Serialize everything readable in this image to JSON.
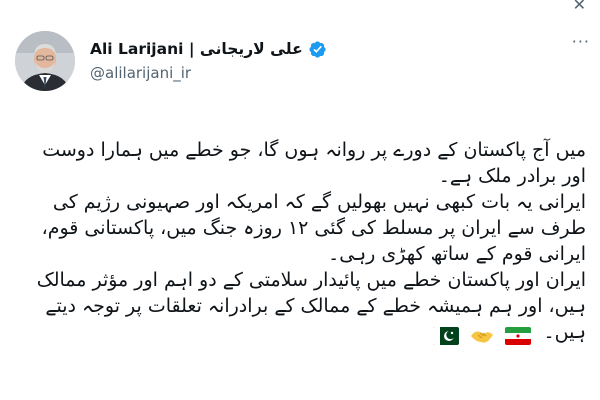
{
  "header": {
    "display_name": "Ali Larijani | علی لاریجانی",
    "handle": "@alilarijani_ir",
    "verified": true,
    "close_icon": "close-icon",
    "more_icon": "more-options-icon"
  },
  "tweet": {
    "text": "میں آج پاکستان کے دورے پر روانہ ہوں گا، جو خطے میں ہمارا دوست اور برادر ملک ہے۔\nایرانی یہ بات کبھی نہیں بھولیں گے کہ امریکہ اور صہیونی رژیم کی طرف سے ایران پر مسلط کی گئی ۱۲ روزہ جنگ میں، پاکستانی قوم، ایرانی قوم کے ساتھ کھڑی رہی۔\nایران اور پاکستان خطے میں پائیدار سلامتی کے دو اہم اور مؤثر ممالک ہیں، اور ہم ہمیشہ خطے کے ممالک کے برادرانہ تعلقات پر توجہ دیتے ہیں۔",
    "emojis": [
      "flag-iran",
      "handshake",
      "flag-pakistan"
    ]
  },
  "colors": {
    "text": "#0f1419",
    "secondary": "#536471",
    "verified": "#1d9bf0"
  }
}
